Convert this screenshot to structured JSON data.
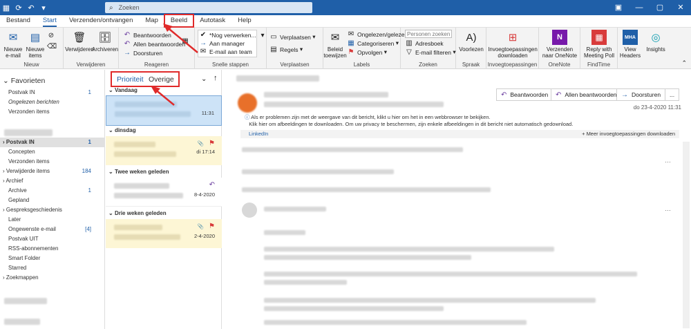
{
  "search": {
    "placeholder": "Zoeken"
  },
  "tabs": [
    {
      "label": "Bestand"
    },
    {
      "label": "Start"
    },
    {
      "label": "Verzenden/ontvangen"
    },
    {
      "label": "Map"
    },
    {
      "label": "Beeld"
    },
    {
      "label": "Autotask"
    },
    {
      "label": "Help"
    }
  ],
  "ribbon": {
    "nieuw": {
      "new_email": "Nieuwe e-mail",
      "new_items": "Nieuwe items",
      "group": "Nieuw"
    },
    "verwijderen": {
      "delete": "Verwijderen",
      "archive": "Archiveren",
      "group": "Verwijderen"
    },
    "reageren": {
      "reply": "Beantwoorden",
      "reply_all": "Allen beantwoorden",
      "forward": "Doorsturen",
      "group": "Reageren"
    },
    "snelle": {
      "s1": "*Nog verwerken...",
      "s2": "Aan manager",
      "s3": "E-mail aan team",
      "group": "Snelle stappen"
    },
    "verplaatsen": {
      "move": "Verplaatsen",
      "rules": "Regels",
      "group": "Verplaatsen"
    },
    "labels": {
      "policy": "Beleid toewijzen",
      "read": "Ongelezen/gelezen",
      "cat": "Categoriseren",
      "follow": "Opvolgen",
      "group": "Labels"
    },
    "zoeken": {
      "people_placeholder": "Personen zoeken",
      "addressbook": "Adresboek",
      "filter": "E-mail filteren",
      "group": "Zoeken"
    },
    "spraak": {
      "read_aloud": "Voorlezen",
      "group": "Spraak"
    },
    "invoeg": {
      "get": "Invoegtoepassingen downloaden",
      "group": "Invoegtoepassingen"
    },
    "onenote": {
      "send": "Verzenden naar OneNote",
      "group": "OneNote"
    },
    "findtime": {
      "reply": "Reply with Meeting Poll",
      "group": "FindTime"
    },
    "mha": {
      "label": "View Headers",
      "icon_text": "MHA"
    },
    "insights": {
      "label": "Insights"
    }
  },
  "nav": {
    "favorites": "Favorieten",
    "fav_items": [
      {
        "label": "Postvak IN",
        "count": "1"
      },
      {
        "label": "Ongelezen berichten",
        "count": ""
      },
      {
        "label": "Verzonden items",
        "count": ""
      }
    ],
    "folders": [
      {
        "label": "Postvak IN",
        "count": "1"
      },
      {
        "label": "Concepten",
        "count": ""
      },
      {
        "label": "Verzonden items",
        "count": ""
      },
      {
        "label": "Verwijderde items",
        "count": "184"
      },
      {
        "label": "Archief",
        "count": ""
      },
      {
        "label": "Archive",
        "count": "1"
      },
      {
        "label": "Gepland",
        "count": ""
      },
      {
        "label": "Gespreksgeschiedenis",
        "count": ""
      },
      {
        "label": "Later",
        "count": ""
      },
      {
        "label": "Ongewenste e-mail",
        "count": "[4]"
      },
      {
        "label": "Postvak UIT",
        "count": ""
      },
      {
        "label": "RSS-abonnementen",
        "count": ""
      },
      {
        "label": "Smart Folder",
        "count": ""
      },
      {
        "label": "Starred",
        "count": ""
      },
      {
        "label": "Zoekmappen",
        "count": ""
      }
    ]
  },
  "msglist": {
    "focused": "Prioriteit",
    "other": "Overige",
    "groups": [
      {
        "label": "Vandaag",
        "time": "11:31"
      },
      {
        "label": "dinsdag",
        "time": "di 17:14"
      },
      {
        "label": "Twee weken geleden",
        "time": "8-4-2020"
      },
      {
        "label": "Drie weken geleden",
        "time": "2-4-2020"
      }
    ]
  },
  "reading": {
    "reply": "Beantwoorden",
    "reply_all": "Allen beantwoorden",
    "forward": "Doorsturen",
    "more": "...",
    "date": "do 23-4-2020 11:31",
    "info1": "Als er problemen zijn met de weergave van dit bericht, klikt u hier om het in een webbrowser te bekijken.",
    "info2": "Klik hier om afbeeldingen te downloaden. Om uw privacy te beschermen, zijn enkele afbeeldingen in dit bericht niet automatisch gedownload.",
    "linkedin": "LinkedIn",
    "more_addins": "Meer invoegtoepassingen downloaden"
  },
  "colors": {
    "accent": "#1f5fa8",
    "highlight": "#e02a2a",
    "flag": "#d83b3b",
    "unread_bg": "#fdf6d5",
    "selected_bg": "#cde3f7"
  }
}
